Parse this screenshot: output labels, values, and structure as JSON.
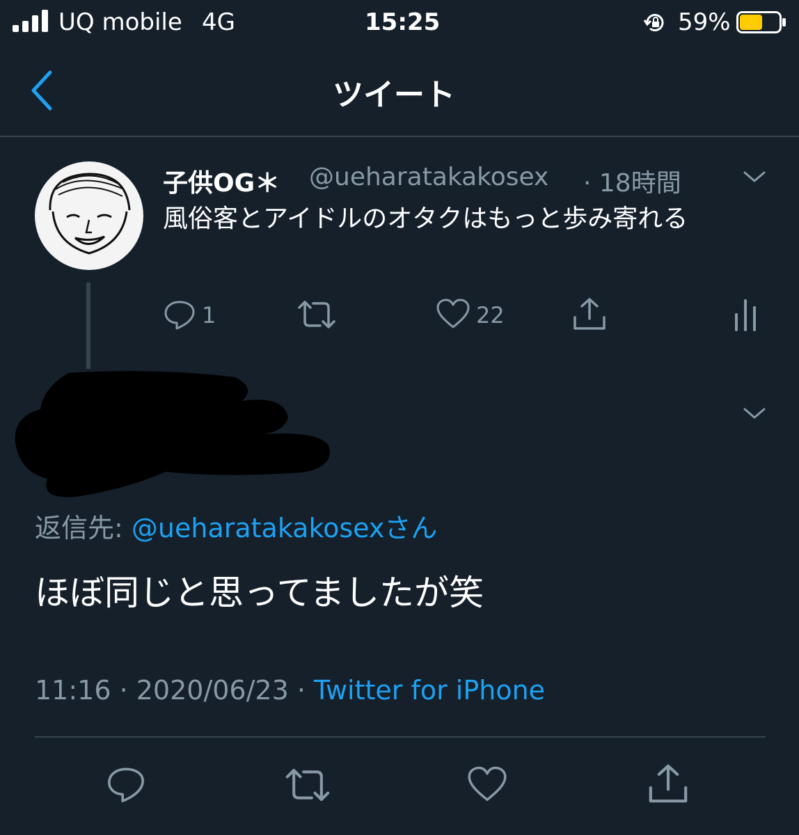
{
  "status_bar": {
    "carrier": "UQ mobile",
    "network": "4G",
    "time": "15:25",
    "battery_percent": "59%",
    "battery_level": 0.59,
    "battery_color": "#ffcc00",
    "signal_icon": "signal-bars-icon",
    "rotation_lock_icon": "rotation-lock-icon"
  },
  "nav": {
    "back_icon": "chevron-left-icon",
    "title": "ツイート"
  },
  "parent_tweet": {
    "display_name": "子供OG＊",
    "handle": "@ueharatakakosex",
    "time_ago": "· 18時間",
    "text": "風俗客とアイドルのオタクはもっと歩み寄れる",
    "reply_count": "1",
    "like_count": "22"
  },
  "main_tweet": {
    "reply_to_label": "返信先: ",
    "reply_to_handle": "@ueharatakakosex",
    "reply_to_suffix": "さん",
    "text": "ほぼ同じと思ってましたが笑",
    "time": "11:16 · 2020/06/23 · ",
    "source": "Twitter for iPhone"
  },
  "colors": {
    "background": "#15202b",
    "accent": "#1da1f2",
    "muted": "#8899a6",
    "divider": "#38444d"
  }
}
